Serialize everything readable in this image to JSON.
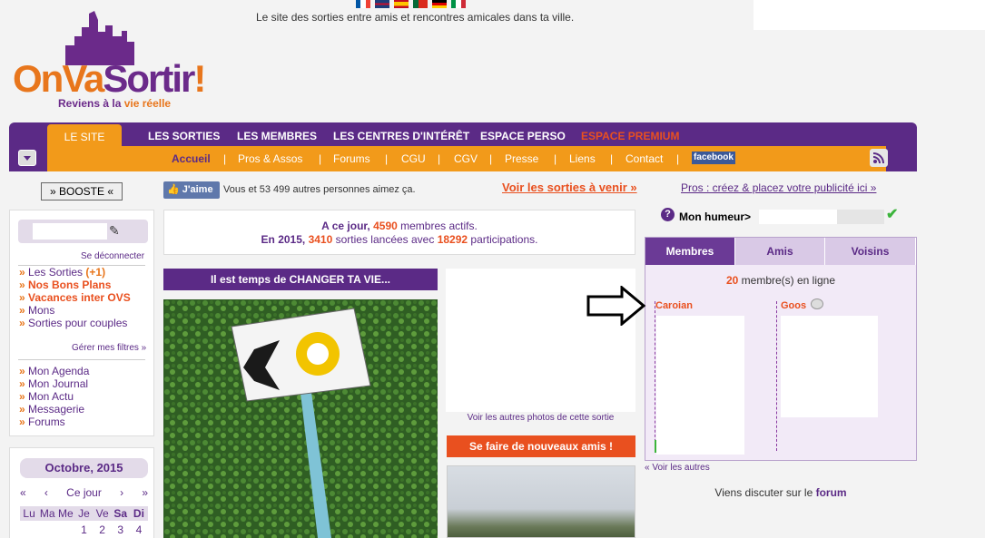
{
  "header": {
    "tagline": "Le site des sorties entre amis et rencontres amicales dans ta ville.",
    "logo_text_orange": "OnVa",
    "logo_text_purple": "Sortir",
    "logo_exclaim": "!",
    "logo_sub_start": "Reviens à la",
    "logo_sub_end": "vie réelle"
  },
  "nav": {
    "tab_le_site": "LE SITE",
    "main": [
      "LES SORTIES",
      "LES MEMBRES",
      "LES CENTRES D'INTÉRÊT",
      "ESPACE PERSO",
      "ESPACE PREMIUM"
    ],
    "sub": [
      "Accueil",
      "Pros & Assos",
      "Forums",
      "CGU",
      "CGV",
      "Presse",
      "Liens",
      "Contact"
    ],
    "facebook": "facebook"
  },
  "left": {
    "boost": "» BOOSTE «",
    "deconnect": "Se déconnecter",
    "items": [
      "Les Sorties",
      "Nos Bons Plans",
      "Vacances inter OVS",
      "Mons",
      "Sorties pour couples"
    ],
    "sorties_count": "(+1)",
    "gerer": "Gérer mes filtres »",
    "perso": [
      "Mon Agenda",
      "Mon Journal",
      "Mon Actu",
      "Messagerie",
      "Forums"
    ]
  },
  "calendar": {
    "month": "Octobre, 2015",
    "nav": [
      "«",
      "‹",
      "Ce jour",
      "›",
      "»"
    ],
    "days": [
      "Lu",
      "Ma",
      "Me",
      "Je",
      "Ve",
      "Sa",
      "Di"
    ],
    "row1": [
      "",
      "",
      "",
      "1",
      "2",
      "3",
      "4"
    ]
  },
  "center": {
    "jaime": "J'aime",
    "fb_like": "Vous et 53 499 autres personnes aimez ça.",
    "voir_sorties": "Voir les sorties à venir »",
    "stats1_pre": "A ce jour,",
    "stats1_num": "4590",
    "stats1_post": "membres actifs.",
    "stats2_pre": "En 2015,",
    "stats2_num1": "3410",
    "stats2_mid": "sorties lancées avec",
    "stats2_num2": "18292",
    "stats2_post": "participations.",
    "changer": "Il est temps de CHANGER TA VIE...",
    "voir_photos": "Voir les autres photos de cette sortie",
    "amis": "Se faire de nouveaux amis !"
  },
  "right": {
    "pros": "Pros : créez & placez votre publicité ici »",
    "humeur": "Mon humeur>",
    "tabs": [
      "Membres",
      "Amis",
      "Voisins"
    ],
    "online_num": "20",
    "online_text": "membre(s) en ligne",
    "member1": "Caroian",
    "member2": "Goos",
    "voir_autres": "« Voir les autres",
    "discuter_pre": "Viens discuter sur le",
    "discuter_link": "forum"
  },
  "colors": {
    "purple": "#5b2a86",
    "orange": "#f29a1a",
    "red": "#e9501f"
  }
}
